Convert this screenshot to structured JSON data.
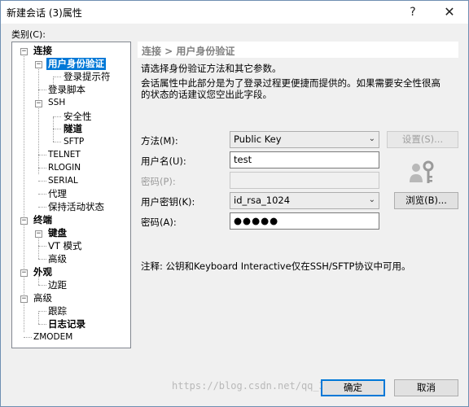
{
  "window": {
    "title": "新建会话 (3)属性",
    "help_glyph": "?",
    "close_glyph": "✕"
  },
  "category_label": "类别(C):",
  "tree": {
    "connection": "连接",
    "user_auth": "用户身份验证",
    "login_prompts": "登录提示符",
    "login_script": "登录脚本",
    "ssh": "SSH",
    "security": "安全性",
    "tunnel": "隧道",
    "sftp": "SFTP",
    "telnet": "TELNET",
    "rlogin": "RLOGIN",
    "serial": "SERIAL",
    "proxy": "代理",
    "keepalive": "保持活动状态",
    "terminal": "终端",
    "keyboard": "键盘",
    "vt_mode": "VT 模式",
    "terminal_advanced": "高级",
    "appearance": "外观",
    "margins": "边距",
    "advanced": "高级",
    "tracking": "跟踪",
    "logging": "日志记录",
    "zmodem": "ZMODEM"
  },
  "panel": {
    "header": "连接 > 用户身份验证",
    "desc1": "请选择身份验证方法和其它参数。",
    "desc2": "会话属性中此部分是为了登录过程更便捷而提供的。如果需要安全性很高",
    "desc3": "的状态的话建议您空出此字段。"
  },
  "form": {
    "method_label": "方法(M):",
    "method_value": "Public Key",
    "settings_button": "设置(S)...",
    "username_label": "用户名(U):",
    "username_value": "test",
    "password_label_disabled": "密码(P):",
    "password_value_disabled": "",
    "user_key_label": "用户密钥(K):",
    "user_key_value": "id_rsa_1024",
    "browse_button": "浏览(B)...",
    "passphrase_label": "密码(A):",
    "passphrase_value": "●●●●●"
  },
  "note": "注释: 公钥和Keyboard Interactive仅在SSH/SFTP协议中可用。",
  "footer": {
    "ok_button": "确定",
    "cancel_button": "取消",
    "watermark": "https://blog.csdn.net/qq_30473777"
  },
  "colors": {
    "selection": "#0078d7",
    "accent_border": "#0078d7"
  },
  "icons": {
    "combo_arrow": "chevron-down-icon",
    "key": "user-key-icon"
  }
}
